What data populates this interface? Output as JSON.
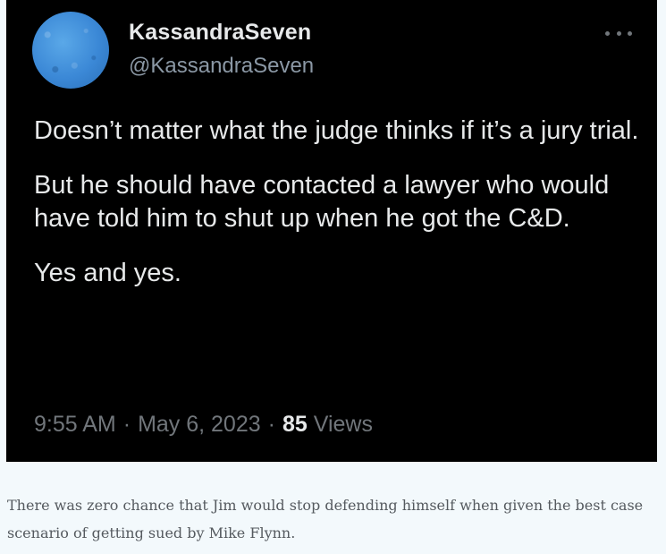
{
  "tweet": {
    "display_name": "KassandraSeven",
    "handle": "@KassandraSeven",
    "more_icon": "more-dots-icon",
    "avatar_icon": "avatar",
    "paragraphs": [
      "Doesn’t matter what the judge thinks if it’s a jury trial.",
      "But he should have contacted a lawyer who would have told him to shut up when he got the C&D.",
      "Yes and yes."
    ],
    "time": "9:55 AM",
    "date": "May 6, 2023",
    "views_count": "85",
    "views_label": "Views",
    "separator": "·"
  },
  "caption": {
    "text": "There was zero chance that Jim would stop defending himself when given the best case scenario of getting sued by Mike Flynn."
  },
  "colors": {
    "card_background": "#000000",
    "primary_text": "#e7e9ea",
    "secondary_text": "#71767b",
    "page_background": "#f3f9fc",
    "caption_text": "#555a5f"
  }
}
